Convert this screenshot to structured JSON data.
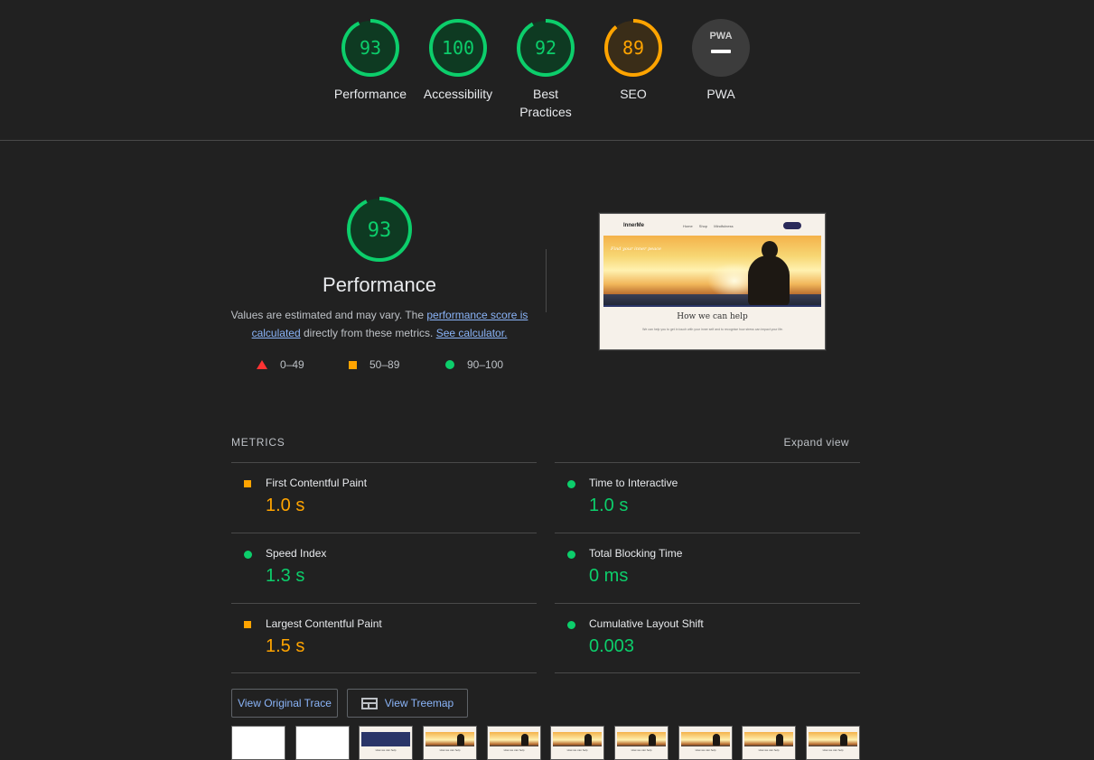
{
  "categories": [
    {
      "label": "Performance",
      "score": "93",
      "value": 93,
      "color": "#0cce6b"
    },
    {
      "label": "Accessibility",
      "score": "100",
      "value": 100,
      "color": "#0cce6b"
    },
    {
      "label": "Best Practices",
      "score": "92",
      "value": 92,
      "color": "#0cce6b"
    },
    {
      "label": "SEO",
      "score": "89",
      "value": 89,
      "color": "#ffa400"
    },
    {
      "label": "PWA",
      "score": "PWA",
      "value": 0,
      "color": "#9aa0a6"
    }
  ],
  "performance": {
    "score": "93",
    "value": 93,
    "title": "Performance",
    "desc_prefix": "Values are estimated and may vary. The ",
    "link_score": "performance score is calculated",
    "desc_middle": " directly from these metrics. ",
    "link_calc": "See calculator."
  },
  "legend": [
    {
      "range": "0–49",
      "shape": "triangle",
      "color": "#ff3333"
    },
    {
      "range": "50–89",
      "shape": "square",
      "color": "#ffa400"
    },
    {
      "range": "90–100",
      "shape": "circle",
      "color": "#0cce6b"
    }
  ],
  "screenshot": {
    "logo": "InnerMe",
    "nav_links": "Home Shop Mindfulness",
    "tagline": "Find your inner peace",
    "heading": "How we can help",
    "body": "We can help you to get in touch with your inner self and to recognise how stress can impact your life."
  },
  "metrics": {
    "title": "METRICS",
    "expand_label": "Expand view",
    "items": [
      {
        "name": "First Contentful Paint",
        "value": "1.0 s",
        "status": "average"
      },
      {
        "name": "Time to Interactive",
        "value": "1.0 s",
        "status": "pass"
      },
      {
        "name": "Speed Index",
        "value": "1.3 s",
        "status": "pass"
      },
      {
        "name": "Total Blocking Time",
        "value": "0 ms",
        "status": "pass"
      },
      {
        "name": "Largest Contentful Paint",
        "value": "1.5 s",
        "status": "average"
      },
      {
        "name": "Cumulative Layout Shift",
        "value": "0.003",
        "status": "pass"
      }
    ]
  },
  "buttons": {
    "trace": "View Original Trace",
    "treemap": "View Treemap"
  },
  "filmstrip": {
    "frames": [
      "blank",
      "blank",
      "blue",
      "full",
      "full",
      "full",
      "full",
      "full",
      "full",
      "full"
    ]
  }
}
